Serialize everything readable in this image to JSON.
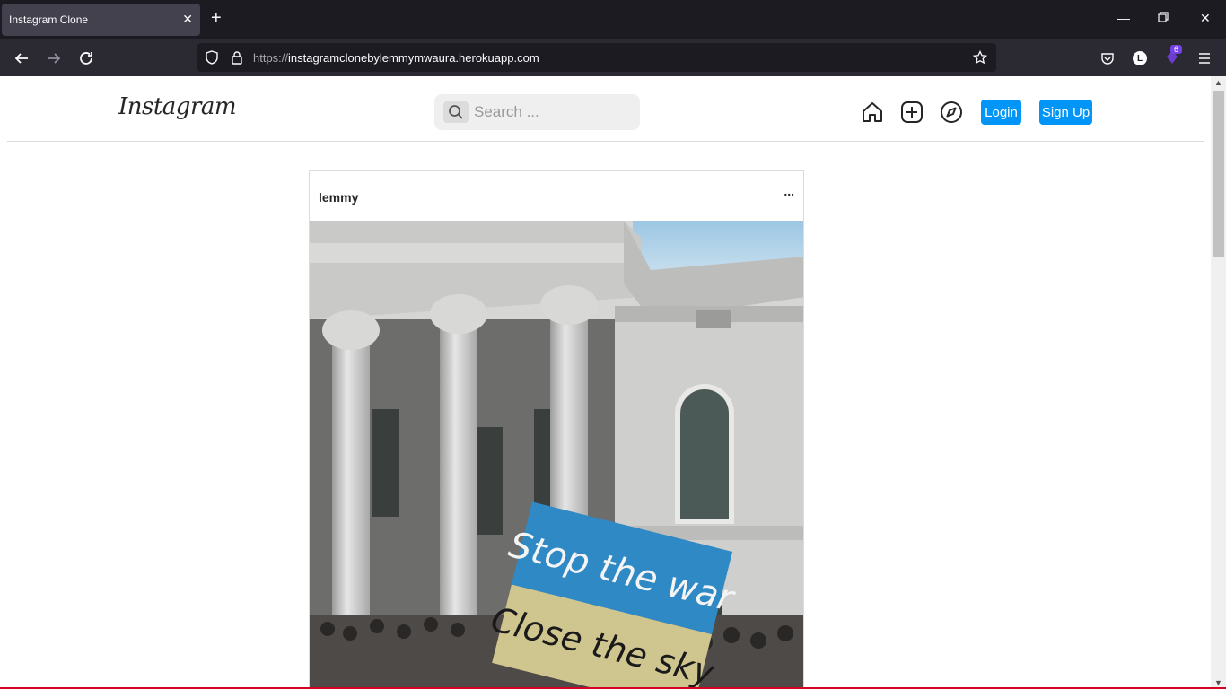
{
  "browser": {
    "tab_title": "Instagram Clone",
    "url_scheme": "https://",
    "url_host": "instagramclonebylemmymwaura.herokuapp.com",
    "profile_initial": "L",
    "extension_badge": "6"
  },
  "header": {
    "logo": "Instagram",
    "search_placeholder": "Search ...",
    "login_label": "Login",
    "signup_label": "Sign Up",
    "accent_color": "#0095f6"
  },
  "post": {
    "username": "lemmy",
    "more_label": "...",
    "sign_line1": "Stop the war",
    "sign_line2": "Close the sky"
  }
}
